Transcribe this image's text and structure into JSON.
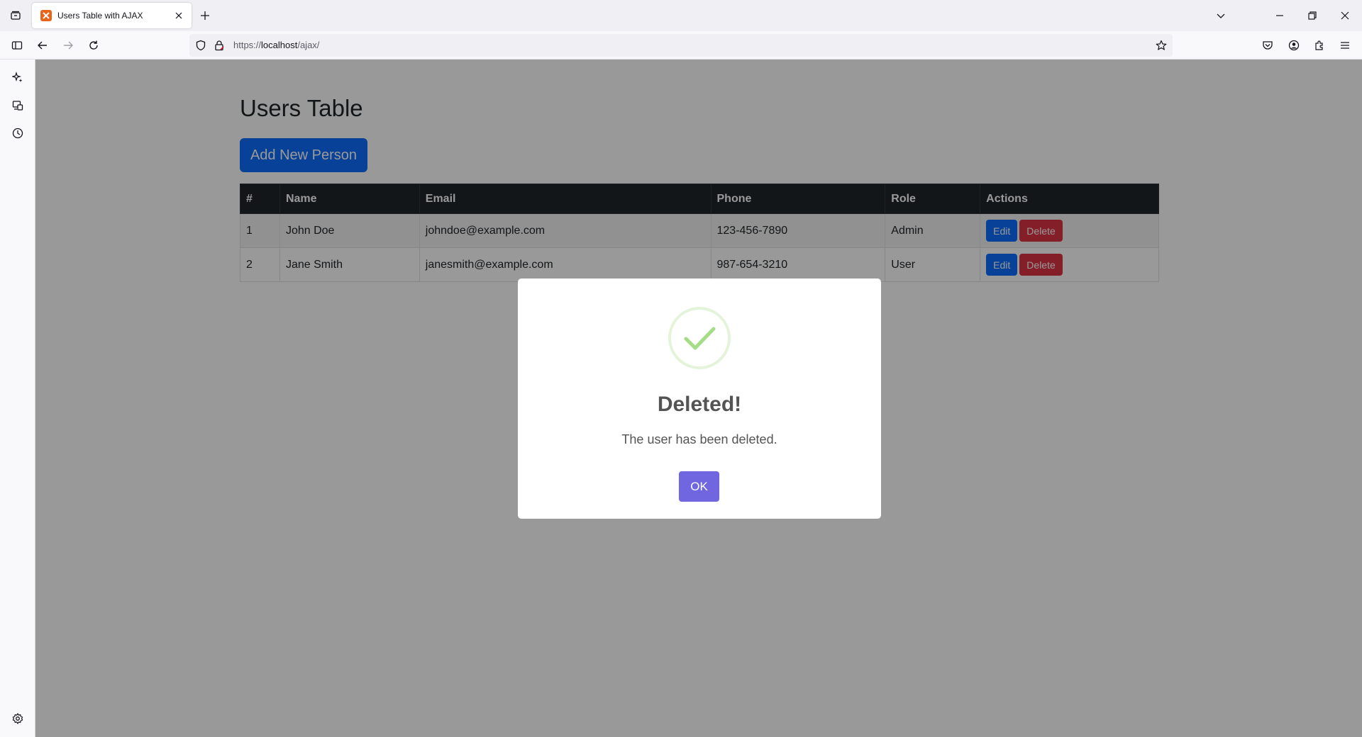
{
  "browser": {
    "tab_title": "Users Table with AJAX",
    "url_scheme": "https://",
    "url_host": "localhost",
    "url_path": "/ajax/"
  },
  "page": {
    "title": "Users Table",
    "add_button": "Add New Person"
  },
  "table": {
    "headers": [
      "#",
      "Name",
      "Email",
      "Phone",
      "Role",
      "Actions"
    ],
    "rows": [
      {
        "id": "1",
        "name": "John Doe",
        "email": "johndoe@example.com",
        "phone": "123-456-7890",
        "role": "Admin",
        "edit": "Edit",
        "delete": "Delete"
      },
      {
        "id": "2",
        "name": "Jane Smith",
        "email": "janesmith@example.com",
        "phone": "987-654-3210",
        "role": "User",
        "edit": "Edit",
        "delete": "Delete"
      }
    ]
  },
  "modal": {
    "icon": "success-check-icon",
    "title": "Deleted!",
    "text": "The user has been deleted.",
    "ok_label": "OK"
  },
  "colors": {
    "primary": "#0d6efd",
    "danger": "#dc3545",
    "table_header": "#212529",
    "modal_confirm": "#7066e0",
    "success_check": "#a5dc86"
  }
}
